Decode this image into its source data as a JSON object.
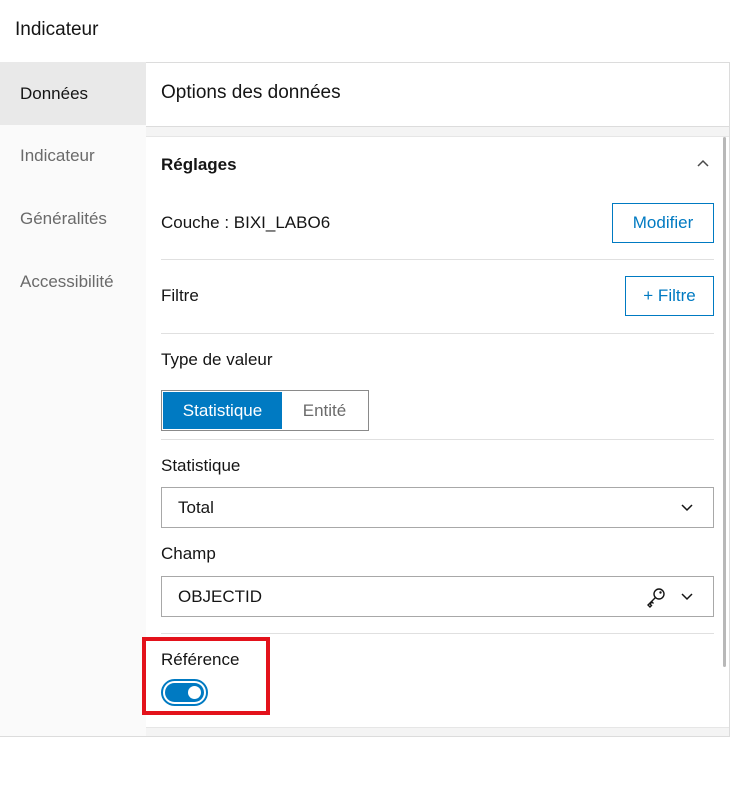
{
  "window": {
    "title": "Indicateur"
  },
  "sidebar": {
    "items": [
      {
        "label": "Données",
        "active": true
      },
      {
        "label": "Indicateur",
        "active": false
      },
      {
        "label": "Généralités",
        "active": false
      },
      {
        "label": "Accessibilité",
        "active": false
      }
    ]
  },
  "main": {
    "title": "Options des données",
    "settings": {
      "title": "Réglages",
      "layer_label": "Couche : BIXI_LABO6",
      "modify_button": "Modifier",
      "filter_label": "Filtre",
      "add_filter_button": "+ Filtre",
      "value_type_label": "Type de valeur",
      "value_type_options": [
        "Statistique",
        "Entité"
      ],
      "value_type_selected": "Statistique",
      "statistic_label": "Statistique",
      "statistic_value": "Total",
      "field_label": "Champ",
      "field_value": "OBJECTID",
      "reference_label": "Référence",
      "reference_enabled": true
    }
  },
  "colors": {
    "accent": "#007ac2",
    "highlight": "#e3121b"
  },
  "icons": [
    "chevron-up-icon",
    "chevron-down-icon",
    "key-icon"
  ]
}
